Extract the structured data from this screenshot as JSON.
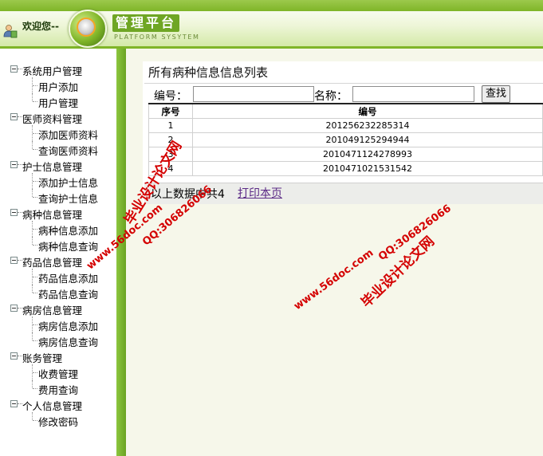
{
  "header": {
    "welcome": "欢迎您--",
    "platform_title": "管理平台",
    "platform_subtitle": "PLATFORM SYSYTEM",
    "user_icon": "user-icon",
    "logo_icon": "logo-icon"
  },
  "sidebar": {
    "groups": [
      {
        "label": "系统用户管理",
        "items": [
          "用户添加",
          "用户管理"
        ]
      },
      {
        "label": "医师资料管理",
        "items": [
          "添加医师资料",
          "查询医师资料"
        ]
      },
      {
        "label": "护士信息管理",
        "items": [
          "添加护士信息",
          "查询护士信息"
        ]
      },
      {
        "label": "病种信息管理",
        "items": [
          "病种信息添加",
          "病种信息查询"
        ]
      },
      {
        "label": "药品信息管理",
        "items": [
          "药品信息添加",
          "药品信息查询"
        ]
      },
      {
        "label": "病房信息管理",
        "items": [
          "病房信息添加",
          "病房信息查询"
        ]
      },
      {
        "label": "账务管理",
        "items": [
          "收费管理",
          "费用查询"
        ]
      },
      {
        "label": "个人信息管理",
        "items": [
          "修改密码"
        ]
      }
    ]
  },
  "main": {
    "title": "所有病种信息信息列表",
    "search": {
      "code_label": "编号：",
      "code_value": "",
      "name_label": "名称：",
      "name_value": "",
      "button": "查找"
    },
    "table": {
      "columns": [
        "序号",
        "编号"
      ],
      "rows": [
        [
          "1",
          "201256232285314"
        ],
        [
          "2",
          "201049125294944"
        ],
        [
          "3",
          "2010471124278993"
        ],
        [
          "4",
          "2010471021531542"
        ]
      ]
    },
    "footer_text": "以上数据中共4",
    "print_link": "打印本页"
  },
  "watermark": {
    "cn": "毕业设计论文网",
    "url": "www.56doc.com",
    "qq": "QQ:306826066"
  },
  "colors": {
    "accent": "#7fb528",
    "background": "#f6f7ea",
    "link": "#5b2a86",
    "watermark": "#d40000"
  }
}
